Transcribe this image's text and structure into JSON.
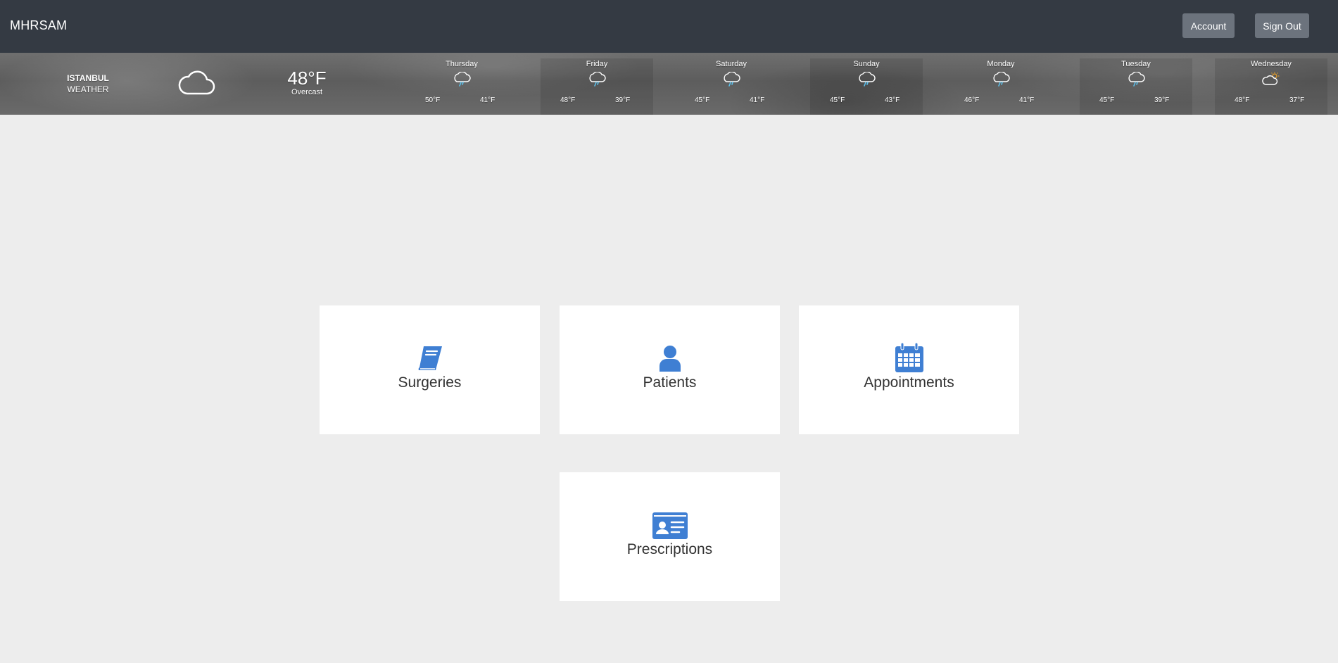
{
  "header": {
    "brand": "MHRSAM",
    "account_label": "Account",
    "signout_label": "Sign Out"
  },
  "weather": {
    "city": "ISTANBUL",
    "subtitle": "WEATHER",
    "current_temp": "48°F",
    "current_condition": "Overcast",
    "current_icon": "cloud-icon",
    "forecast": [
      {
        "day": "Thursday",
        "high": "50°F",
        "low": "41°F",
        "icon": "rain-cloud-icon"
      },
      {
        "day": "Friday",
        "high": "48°F",
        "low": "39°F",
        "icon": "rain-cloud-icon"
      },
      {
        "day": "Saturday",
        "high": "45°F",
        "low": "41°F",
        "icon": "rain-cloud-icon"
      },
      {
        "day": "Sunday",
        "high": "45°F",
        "low": "43°F",
        "icon": "rain-cloud-icon"
      },
      {
        "day": "Monday",
        "high": "46°F",
        "low": "41°F",
        "icon": "rain-cloud-icon"
      },
      {
        "day": "Tuesday",
        "high": "45°F",
        "low": "39°F",
        "icon": "rain-cloud-icon"
      },
      {
        "day": "Wednesday",
        "high": "48°F",
        "low": "37°F",
        "icon": "partly-sunny-cloud-icon"
      }
    ]
  },
  "menu": {
    "tiles": [
      {
        "label": "Surgeries",
        "icon": "book-icon"
      },
      {
        "label": "Patients",
        "icon": "user-icon"
      },
      {
        "label": "Appointments",
        "icon": "calendar-icon"
      },
      {
        "label": "Prescriptions",
        "icon": "id-card-icon"
      }
    ]
  },
  "colors": {
    "navbar": "#343a43",
    "nav_button": "#6c737d",
    "page_background": "#ededed",
    "icon_accent": "#3f7fd3",
    "rain_drop": "#5bc0eb",
    "sun": "#f5a623"
  }
}
